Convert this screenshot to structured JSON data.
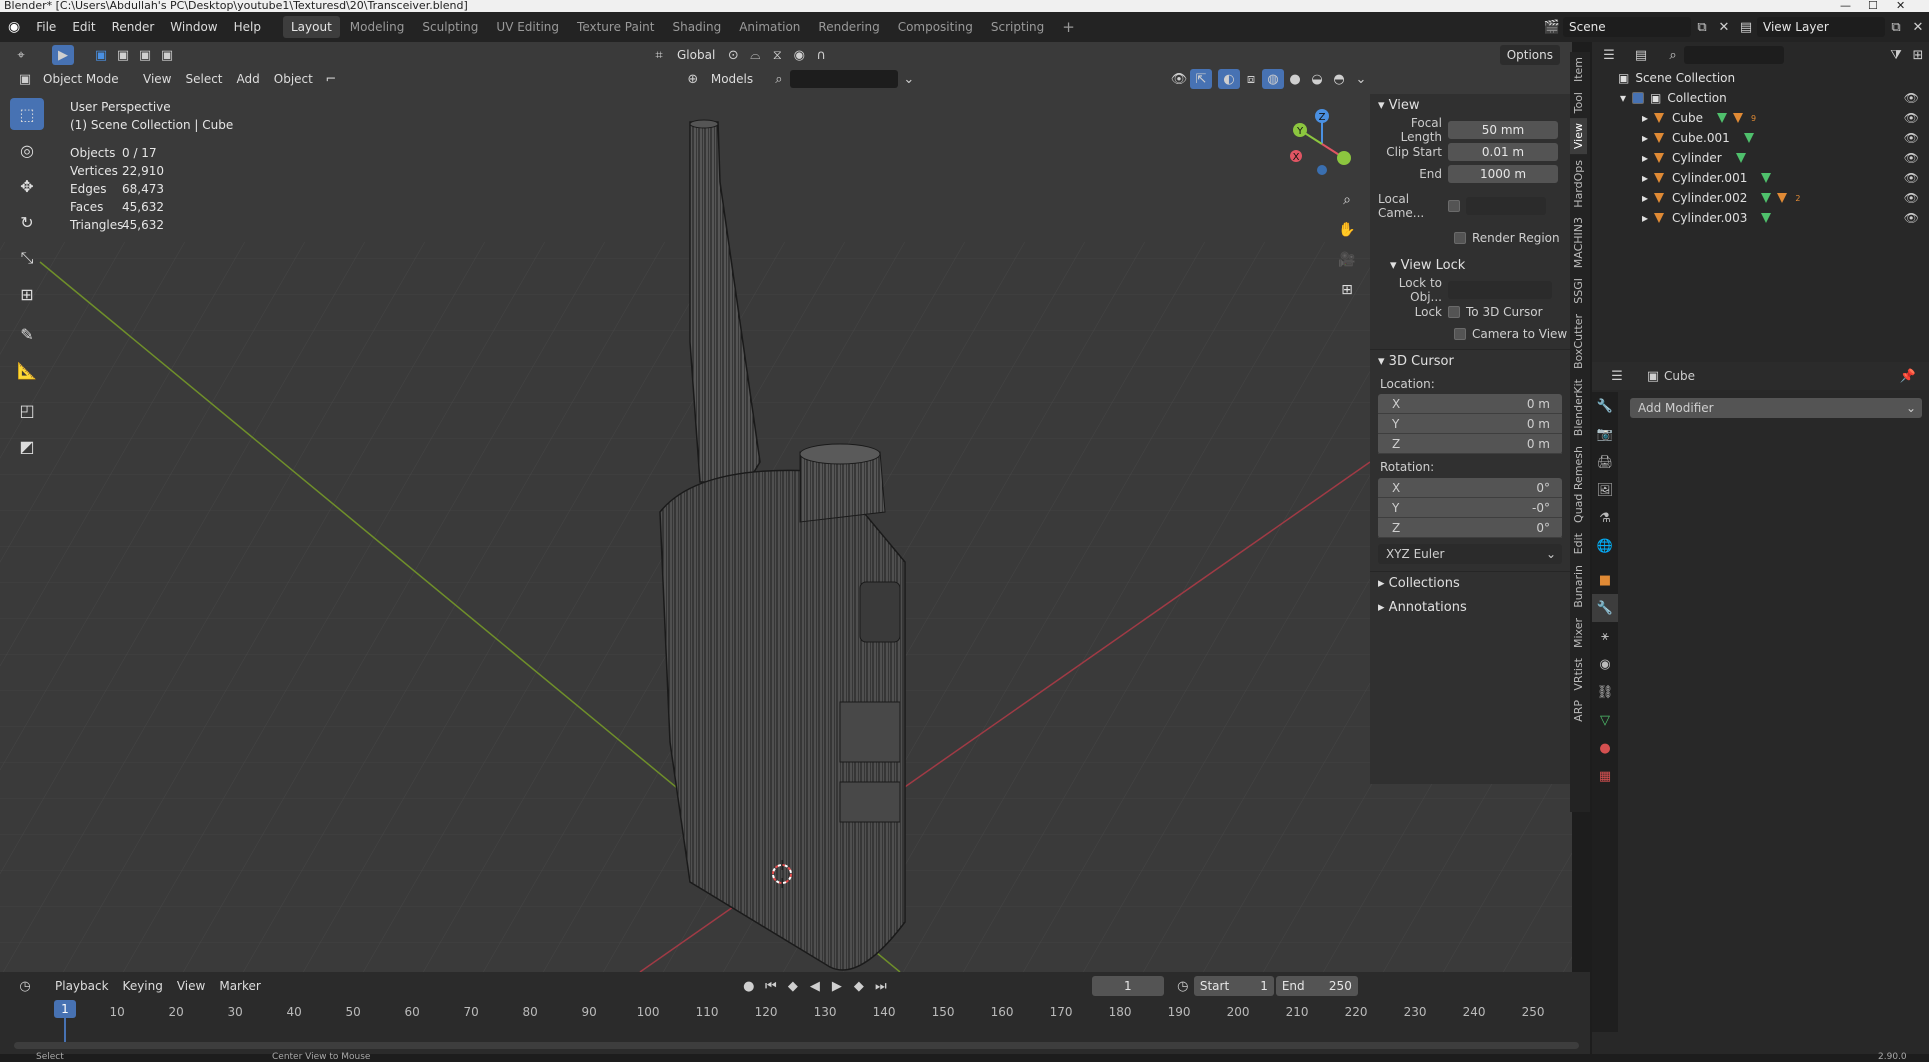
{
  "window": {
    "title": "Blender* [C:\\Users\\Abdullah's PC\\Desktop\\youtube1\\Texturesd\\20\\Transceiver.blend]"
  },
  "topbar": {
    "menus": [
      "File",
      "Edit",
      "Render",
      "Window",
      "Help"
    ],
    "workspaces": [
      "Layout",
      "Modeling",
      "Sculpting",
      "UV Editing",
      "Texture Paint",
      "Shading",
      "Animation",
      "Rendering",
      "Compositing",
      "Scripting"
    ],
    "active_workspace": "Layout",
    "scene": "Scene",
    "view_layer": "View Layer"
  },
  "viewport": {
    "orientation": "Global",
    "options_label": "Options",
    "mode": "Object Mode",
    "menus": [
      "View",
      "Select",
      "Add",
      "Object"
    ],
    "collection_filter": "Models",
    "perspective_label": "User Perspective",
    "collection_label": "(1) Scene Collection | Cube",
    "stats": [
      {
        "label": "Objects",
        "value": "0 / 17"
      },
      {
        "label": "Vertices",
        "value": "22,910"
      },
      {
        "label": "Edges",
        "value": "68,473"
      },
      {
        "label": "Faces",
        "value": "45,632"
      },
      {
        "label": "Triangles",
        "value": "45,632"
      }
    ],
    "gizmo_axes": {
      "x": "X",
      "y": "Y",
      "z": "Z"
    },
    "colors": {
      "x_axis": "#e05563",
      "y_axis": "#8cc63f",
      "z_axis": "#4a90e2",
      "active": "#4772b3"
    }
  },
  "npanel": {
    "view_header": "View",
    "focal_length_label": "Focal Length",
    "focal_length": "50 mm",
    "clip_start_label": "Clip Start",
    "clip_start": "0.01 m",
    "clip_end_label": "End",
    "clip_end": "1000 m",
    "local_camera_label": "Local Came...",
    "render_region_label": "Render Region",
    "view_lock_header": "View Lock",
    "lock_to_obj_label": "Lock to Obj...",
    "lock_label": "Lock",
    "to_3d_cursor_label": "To 3D Cursor",
    "camera_to_view_label": "Camera to View",
    "cursor_header": "3D Cursor",
    "location_label": "Location:",
    "location": [
      {
        "axis": "X",
        "value": "0 m"
      },
      {
        "axis": "Y",
        "value": "0 m"
      },
      {
        "axis": "Z",
        "value": "0 m"
      }
    ],
    "rotation_label": "Rotation:",
    "rotation": [
      {
        "axis": "X",
        "value": "0°"
      },
      {
        "axis": "Y",
        "value": "-0°"
      },
      {
        "axis": "Z",
        "value": "0°"
      }
    ],
    "rotation_mode": "XYZ Euler",
    "collections_label": "Collections",
    "annotations_label": "Annotations",
    "tabs": [
      "Item",
      "Tool",
      "View",
      "HardOps",
      "MACHIN3",
      "SSGI",
      "BoxCutter",
      "BlenderKit",
      "Quad Remesh",
      "Edit",
      "Bunarin",
      "Mixer",
      "VRtist",
      "ARP"
    ],
    "active_tab": "View"
  },
  "outliner": {
    "root": "Scene Collection",
    "collection": "Collection",
    "items": [
      {
        "name": "Cube",
        "badge": "9"
      },
      {
        "name": "Cube.001",
        "badge": ""
      },
      {
        "name": "Cylinder",
        "badge": ""
      },
      {
        "name": "Cylinder.001",
        "badge": ""
      },
      {
        "name": "Cylinder.002",
        "badge": "2"
      },
      {
        "name": "Cylinder.003",
        "badge": ""
      }
    ]
  },
  "properties": {
    "object_name": "Cube",
    "add_modifier": "Add Modifier"
  },
  "timeline": {
    "menus": [
      "Playback",
      "Keying",
      "View",
      "Marker"
    ],
    "current_frame": "1",
    "start_label": "Start",
    "start": "1",
    "end_label": "End",
    "end": "250",
    "ticks": [
      "1",
      "10",
      "20",
      "30",
      "40",
      "50",
      "60",
      "70",
      "80",
      "90",
      "100",
      "110",
      "120",
      "130",
      "140",
      "150",
      "160",
      "170",
      "180",
      "190",
      "200",
      "210",
      "220",
      "230",
      "240",
      "250"
    ]
  },
  "statusbar": {
    "select": "Select",
    "center_view": "Center View to Mouse",
    "version": "2.90.0"
  }
}
